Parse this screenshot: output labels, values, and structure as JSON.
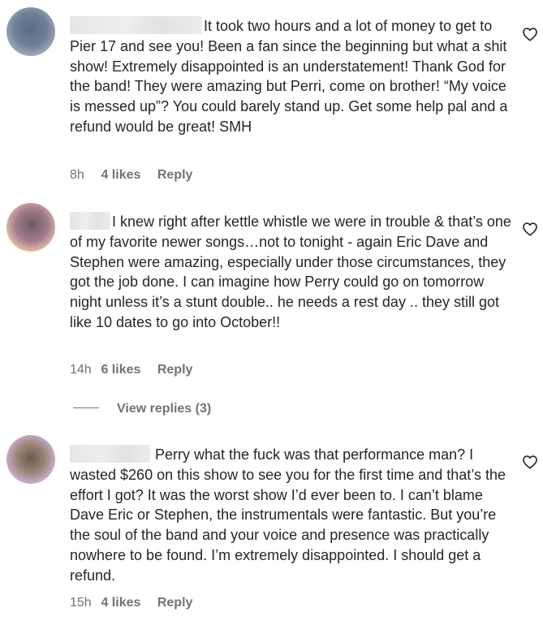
{
  "comments": [
    {
      "text": "It took two hours and a lot of money to get to Pier 17 and see you! Been a fan since the beginning but what a shit show! Extremely disappointed is an understatement! Thank God for the band! They were amazing but Perri, come on brother! “My voice is messed up”? You could barely stand up. Get some help pal and a refund would be great! SMH",
      "time": "8h",
      "likes": "4 likes",
      "reply_label": "Reply"
    },
    {
      "text": "I knew right after kettle whistle we were in trouble & that’s one of my favorite newer songs…not to tonight - again Eric Dave and Stephen were amazing, especially under those circumstances, they got the job done. I can imagine how Perry could go on tomorrow night unless it’s a stunt double.. he needs a rest day .. they still got like 10 dates to go into October!!",
      "time": "14h",
      "likes": "6 likes",
      "reply_label": "Reply"
    },
    {
      "text": "Perry what the fuck was that performance man? I wasted $260 on this show to see you for the first time and that’s the effort I got? It was the worst show I’d ever been to. I can’t blame Dave Eric or Stephen, the instrumentals were fantastic. But you’re the soul of the band and your voice and presence was practically nowhere to be found. I’m extremely disappointed. I should get a refund.",
      "time": "15h",
      "likes": "4 likes",
      "reply_label": "Reply"
    }
  ],
  "view_replies": "View replies (3)",
  "icons": {
    "like": "heart-icon"
  },
  "colors": {
    "text": "#262626",
    "secondary": "#737373",
    "background": "#ffffff"
  }
}
